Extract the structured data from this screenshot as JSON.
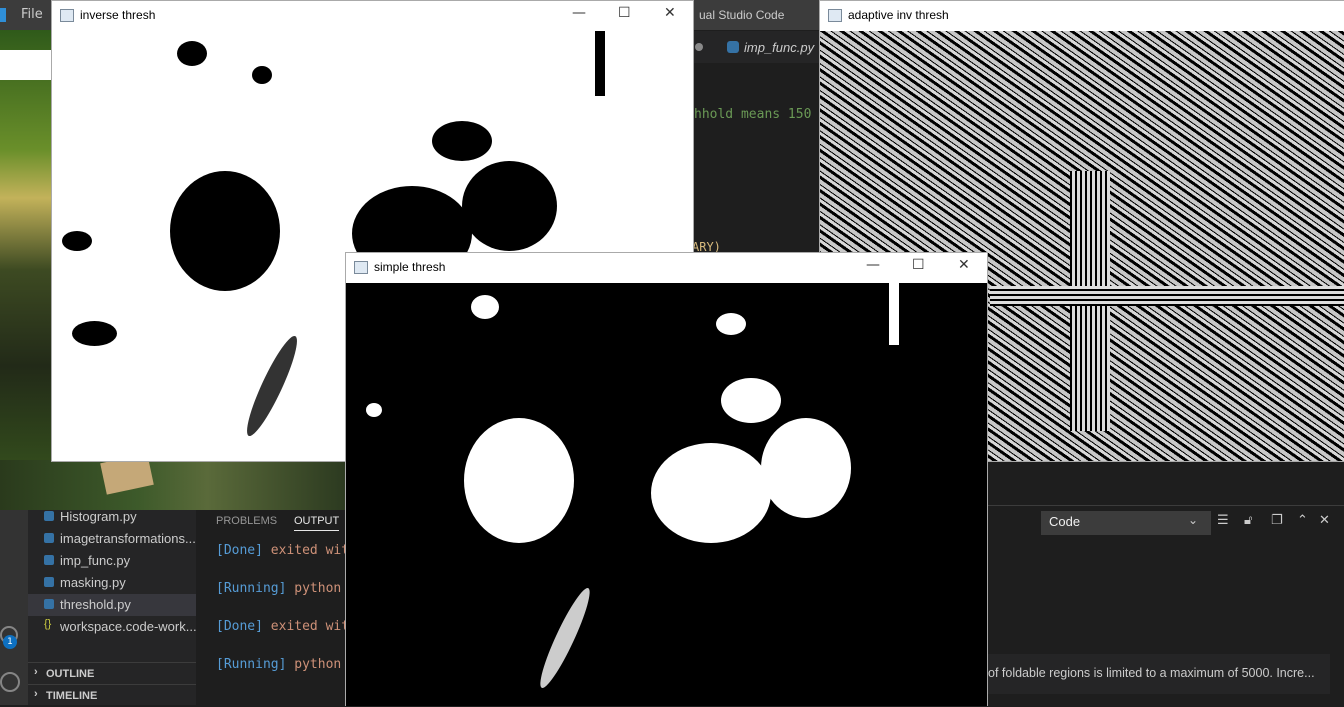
{
  "vscode": {
    "menu_file": "File",
    "window_title": "ual Studio Code",
    "active_tab": "imp_func.py",
    "code_comment": "hhold means 150",
    "code_fragment": "ARY)"
  },
  "sidebar": {
    "files": [
      {
        "name": "Histogram.py",
        "icon": "python-file-icon"
      },
      {
        "name": "imagetransformations...",
        "icon": "python-file-icon"
      },
      {
        "name": "imp_func.py",
        "icon": "python-file-icon"
      },
      {
        "name": "masking.py",
        "icon": "python-file-icon"
      },
      {
        "name": "threshold.py",
        "icon": "python-file-icon",
        "active": true
      },
      {
        "name": "workspace.code-work...",
        "icon": "json-file-icon"
      }
    ],
    "sections": [
      "OUTLINE",
      "TIMELINE"
    ],
    "badge_count": "1"
  },
  "panel": {
    "tabs": [
      "PROBLEMS",
      "OUTPUT"
    ],
    "active_tab": "OUTPUT",
    "output_lines": [
      {
        "bracket": "[Done]",
        "text": "exited wit"
      },
      {
        "bracket": "[Running]",
        "text": "python"
      },
      {
        "bracket": "[Done]",
        "text": "exited wit"
      },
      {
        "bracket": "[Running]",
        "text": "python"
      }
    ],
    "output_channel": "Code",
    "notification": "of foldable regions is limited to a maximum of 5000. Incre..."
  },
  "windows": {
    "inverse": {
      "title": "inverse thresh"
    },
    "simple": {
      "title": "simple thresh"
    },
    "adaptive": {
      "title": "adaptive inv thresh"
    }
  },
  "colors": {
    "accent": "#0e70c0",
    "titlebar": "#3c3c3c",
    "sidebar": "#252526",
    "editor": "#1e1e1e"
  }
}
